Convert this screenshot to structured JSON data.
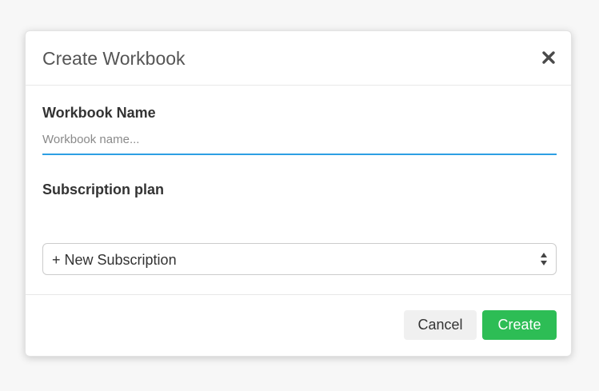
{
  "modal": {
    "title": "Create Workbook",
    "close_icon": "close-icon"
  },
  "workbook_name": {
    "label": "Workbook Name",
    "value": "",
    "placeholder": "Workbook name..."
  },
  "subscription": {
    "label": "Subscription plan",
    "selected": "+ New Subscription",
    "arrow_icon": "select-arrows-icon"
  },
  "footer": {
    "cancel_label": "Cancel",
    "create_label": "Create"
  },
  "colors": {
    "accent": "#2d9fe3",
    "create_button": "#2dbd55",
    "cancel_button": "#f0f0f0"
  }
}
